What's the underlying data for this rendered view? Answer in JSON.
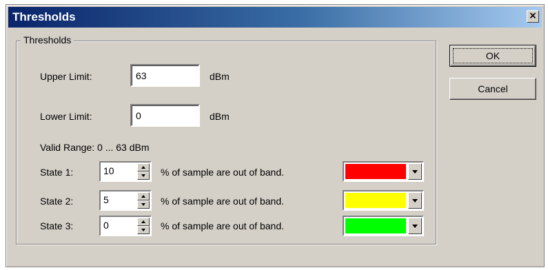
{
  "window": {
    "title": "Thresholds",
    "close_label": "×"
  },
  "group": {
    "title": "Thresholds"
  },
  "upper": {
    "label": "Upper Limit:",
    "value": "63",
    "unit": "dBm"
  },
  "lower": {
    "label": "Lower Limit:",
    "value": "0",
    "unit": "dBm"
  },
  "valid_range": "Valid Range: 0 ... 63 dBm",
  "states": [
    {
      "label": "State 1:",
      "value": "10",
      "text": "% of sample are out of band.",
      "color": "#ff0000"
    },
    {
      "label": "State 2:",
      "value": "5",
      "text": "% of sample are out of band.",
      "color": "#ffff00"
    },
    {
      "label": "State 3:",
      "value": "0",
      "text": "% of sample are out of band.",
      "color": "#00ff00"
    }
  ],
  "buttons": {
    "ok": "OK",
    "cancel": "Cancel"
  }
}
